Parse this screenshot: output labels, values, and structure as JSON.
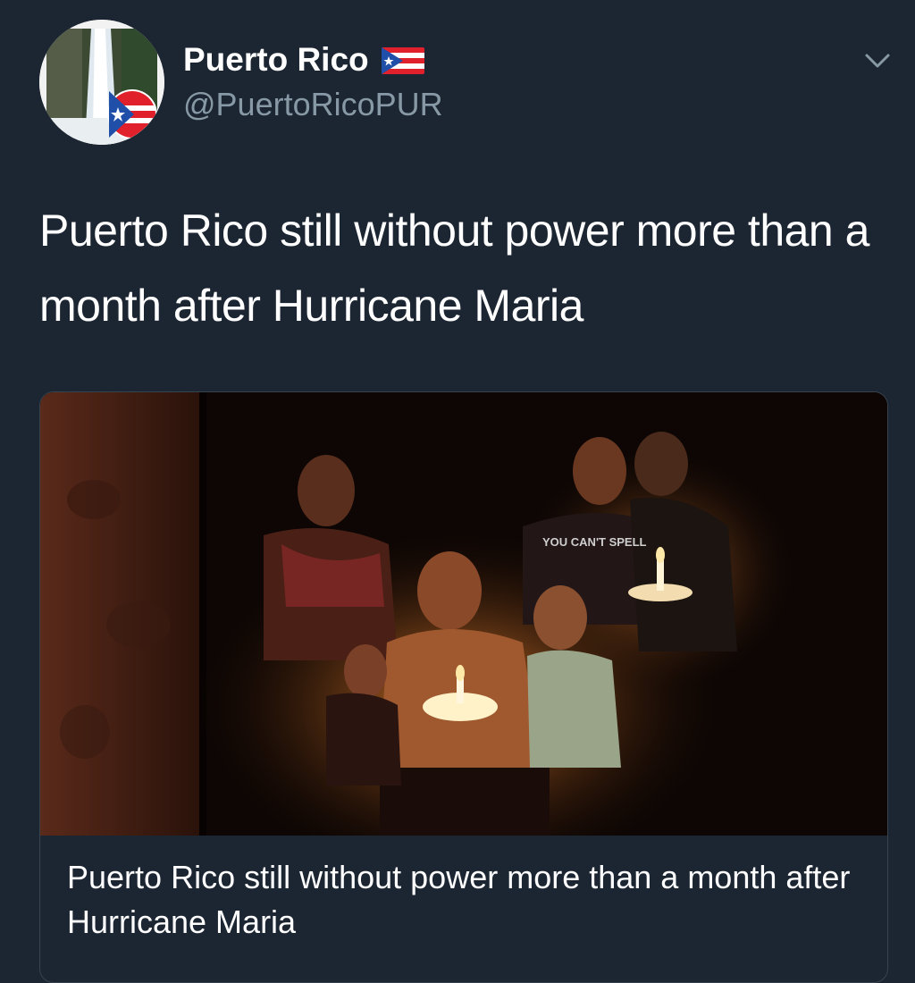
{
  "tweet": {
    "author": {
      "display_name": "Puerto Rico",
      "handle": "@PuertoRicoPUR",
      "avatar_icon": "waterfall-with-puerto-rico-flag-badge",
      "flag_icon": "puerto-rico-flag-icon"
    },
    "menu_icon": "chevron-down-icon",
    "text": "Puerto Rico still without power more than a month after Hurricane Maria",
    "card": {
      "image_description_icon": "family-by-candlelight-photo",
      "title": "Puerto Rico still without power more than a month after Hurricane Maria",
      "shirt_text": "YOU CAN'T SPELL"
    }
  },
  "colors": {
    "background": "#1c2532",
    "text": "#ffffff",
    "secondary_text": "#8899a6",
    "border": "#38444d",
    "flag_red": "#e0202a",
    "flag_blue": "#1f4fa8"
  }
}
